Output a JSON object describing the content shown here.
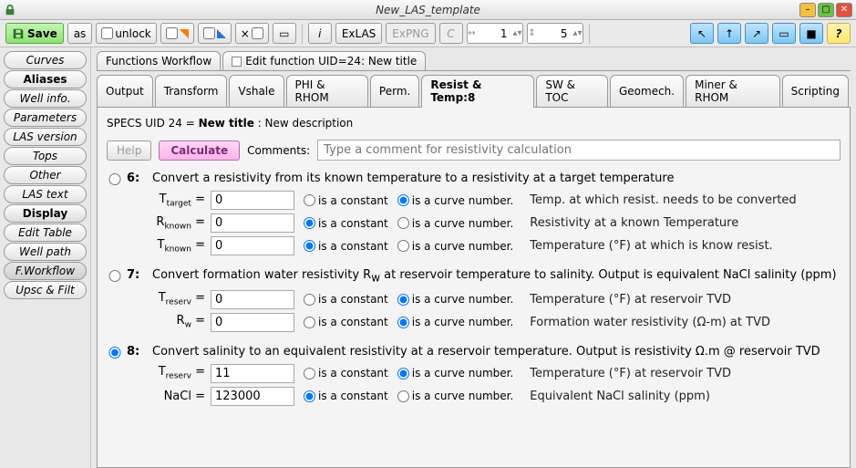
{
  "window": {
    "title": "New_LAS_template"
  },
  "toolbar": {
    "save": "Save",
    "as": "as",
    "unlock": "unlock",
    "exlas": "ExLAS",
    "expng": "ExPNG",
    "c": "C",
    "spin1": "1",
    "spin2": "5",
    "help": "?",
    "info": "i",
    "x": "×"
  },
  "sidebar": {
    "groups": [
      {
        "header": "",
        "items": [
          "Curves",
          "Aliases",
          "Well info.",
          "Parameters",
          "LAS version",
          "Tops",
          "Other",
          "LAS text"
        ]
      },
      {
        "header": "Display",
        "items": [
          "Edit Table",
          "Well path",
          "F.Workflow",
          "Upsc & Filt"
        ]
      }
    ],
    "active": "F.Workflow",
    "bold": "Aliases"
  },
  "tabs_top": [
    {
      "label": "Functions Workflow"
    },
    {
      "label": "Edit function UID=24: New title",
      "chk": true
    }
  ],
  "tabs_sub": [
    "Output",
    "Transform",
    "Vshale",
    "PHI & RHOM",
    "Perm.",
    "Resist & Temp:8",
    "SW & TOC",
    "Geomech.",
    "Miner & RHOM",
    "Scripting"
  ],
  "tabs_sub_active": "Resist & Temp:8",
  "specs": {
    "pre": "SPECS UID 24 = ",
    "title": "New title",
    "post": " : New description"
  },
  "row1": {
    "help": "Help",
    "calc": "Calculate",
    "comments_lbl": "Comments:",
    "comments_ph": "Type a comment for resistivity calculation"
  },
  "opt_const": "is a constant",
  "opt_curve": "is a curve number.",
  "funcs": [
    {
      "n": "6:",
      "sel": false,
      "desc": "Convert a resistivity from its known temperature to a resistivity at a target temperature",
      "params": [
        {
          "lbl": "T",
          "sub": "target",
          "eq": " =",
          "val": "0",
          "c": false,
          "expl": "Temp. at which resist. needs to be converted"
        },
        {
          "lbl": "R",
          "sub": "known",
          "eq": " =",
          "val": "0",
          "c": true,
          "expl": "Resistivity at a known Temperature"
        },
        {
          "lbl": "T",
          "sub": "known",
          "eq": " =",
          "val": "0",
          "c": true,
          "expl": "Temperature (°F) at which is know resist."
        }
      ]
    },
    {
      "n": "7:",
      "sel": false,
      "desc": "Convert formation water resistivity R",
      "desc_sub": "w",
      "desc2": " at reservoir temperature to salinity. Output is equivalent NaCl salinity (ppm)",
      "params": [
        {
          "lbl": "T",
          "sub": "reserv",
          "eq": " =",
          "val": "0",
          "c": false,
          "expl": "Temperature (°F) at reservoir TVD"
        },
        {
          "lbl": "R",
          "sub": "w",
          "eq": " =",
          "val": "0",
          "c": false,
          "expl": "Formation water resistivity (Ω-m) at TVD"
        }
      ]
    },
    {
      "n": "8:",
      "sel": true,
      "desc": "Convert salinity to an equivalent resistivity at a reservoir temperature. Output is resistivity Ω.m @ reservoir TVD",
      "params": [
        {
          "lbl": "T",
          "sub": "reserv",
          "eq": " =",
          "val": "11",
          "c": false,
          "expl": "Temperature (°F) at reservoir TVD"
        },
        {
          "lbl": "NaCl",
          "sub": "",
          "eq": " =",
          "val": "123000",
          "c": true,
          "expl": "Equivalent NaCl salinity (ppm)"
        }
      ]
    }
  ]
}
